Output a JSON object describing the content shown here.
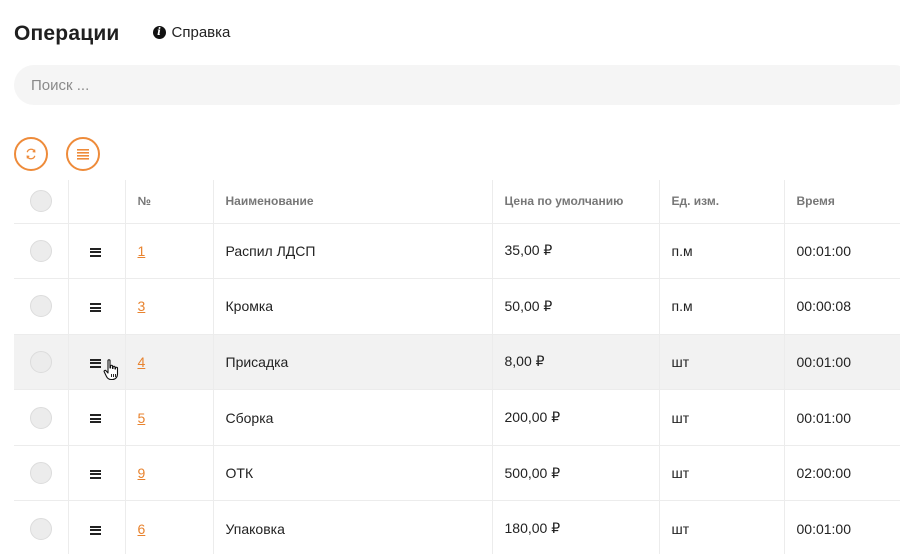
{
  "header": {
    "title": "Операции",
    "help_icon": "info-icon",
    "help_label": "Справка"
  },
  "search": {
    "placeholder": "Поиск ..."
  },
  "toolbar": {
    "refresh_icon": "refresh-icon",
    "menu_icon": "list-menu-icon",
    "accent_color": "#ee8b3a"
  },
  "table": {
    "columns": [
      "",
      "",
      "№",
      "Наименование",
      "Цена по умолчанию",
      "Ед. изм.",
      "Время"
    ],
    "rows": [
      {
        "num": "1",
        "name": "Распил ЛДСП",
        "price": "35,00 ₽",
        "unit": "п.м",
        "time": "00:01:00"
      },
      {
        "num": "3",
        "name": "Кромка",
        "price": "50,00 ₽",
        "unit": "п.м",
        "time": "00:00:08"
      },
      {
        "num": "4",
        "name": "Присадка",
        "price": "8,00 ₽",
        "unit": "шт",
        "time": "00:01:00"
      },
      {
        "num": "5",
        "name": "Сборка",
        "price": "200,00 ₽",
        "unit": "шт",
        "time": "00:01:00"
      },
      {
        "num": "9",
        "name": "ОТК",
        "price": "500,00 ₽",
        "unit": "шт",
        "time": "02:00:00"
      },
      {
        "num": "6",
        "name": "Упаковка",
        "price": "180,00 ₽",
        "unit": "шт",
        "time": "00:01:00"
      }
    ]
  },
  "colors": {
    "link": "#e8832f",
    "row_hover": "#f2f2f2"
  }
}
